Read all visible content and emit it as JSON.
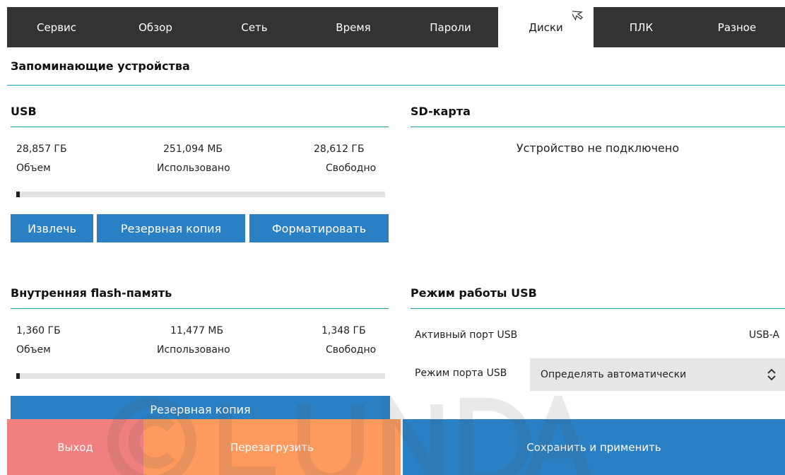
{
  "tabs": [
    {
      "label": "Сервис"
    },
    {
      "label": "Обзор"
    },
    {
      "label": "Сеть"
    },
    {
      "label": "Время"
    },
    {
      "label": "Пароли"
    },
    {
      "label": "Диски"
    },
    {
      "label": "ПЛК"
    },
    {
      "label": "Разное"
    }
  ],
  "active_tab": "Диски",
  "page_title": "Запоминающие устройства",
  "usb": {
    "title": "USB",
    "total_value": "28,857 ГБ",
    "total_label": "Объем",
    "used_value": "251,094 МБ",
    "used_label": "Использовано",
    "free_value": "28,612 ГБ",
    "free_label": "Свободно",
    "usage_fraction": 0.01,
    "buttons": {
      "eject": "Извлечь",
      "backup": "Резервная копия",
      "format": "Форматировать"
    }
  },
  "sd": {
    "title": "SD-карта",
    "status": "Устройство не подключено"
  },
  "flash": {
    "title": "Внутренняя flash-память",
    "total_value": "1,360 ГБ",
    "total_label": "Объем",
    "used_value": "11,477 МБ",
    "used_label": "Использовано",
    "free_value": "1,348 ГБ",
    "free_label": "Свободно",
    "usage_fraction": 0.01,
    "backup_label": "Резервная копия"
  },
  "usb_mode": {
    "title": "Режим работы USB",
    "active_port_label": "Активный порт USB",
    "active_port_value": "USB-A",
    "port_mode_label": "Режим порта USB",
    "port_mode_value": "Определять автоматически"
  },
  "footer": {
    "exit": "Выход",
    "reboot": "Перезагрузить",
    "save_apply": "Сохранить и применить"
  },
  "colors": {
    "tabbar": "#333333",
    "accent_rule": "#1fa0a8",
    "primary_button": "#2980c4",
    "exit_button": "#f07f7f",
    "reboot_button": "#ff9a5e",
    "save_button": "#2980c4"
  },
  "icons": {
    "cursor": "mouse-pointer-icon",
    "select_arrows": "up-down-chevron-icon",
    "watermark": "copyright-watermark"
  }
}
